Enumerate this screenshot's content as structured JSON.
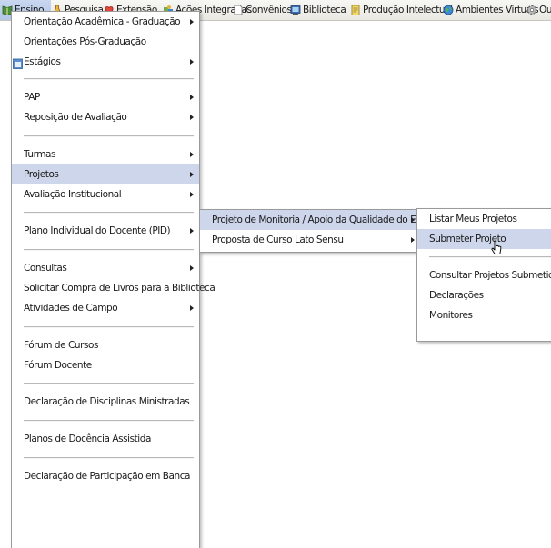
{
  "menubar": {
    "items": [
      {
        "label": "Ensino",
        "icon": "book-icon"
      },
      {
        "label": "Pesquisa",
        "icon": "flask-icon"
      },
      {
        "label": "Extensão",
        "icon": "heart-icon"
      },
      {
        "label": "Ações Integradas",
        "icon": "puzzle-icon"
      },
      {
        "label": "Convênios",
        "icon": "document-icon"
      },
      {
        "label": "Biblioteca",
        "icon": "monitor-icon"
      },
      {
        "label": "Produção Intelectual",
        "icon": "notepad-icon"
      },
      {
        "label": "Ambientes Virtuais",
        "icon": "globe-icon"
      },
      {
        "label": "Outros",
        "icon": "gear-icon"
      }
    ]
  },
  "ensino_menu": {
    "items": [
      {
        "label": "Orientação Acadêmica - Graduação",
        "submenu": true
      },
      {
        "label": "Orientações Pós-Graduação",
        "submenu": false
      },
      {
        "label": "Estágios",
        "submenu": true
      },
      {
        "label": "PAP",
        "submenu": true
      },
      {
        "label": "Reposição de Avaliação",
        "submenu": true
      },
      {
        "label": "Turmas",
        "submenu": true
      },
      {
        "label": "Projetos",
        "submenu": true
      },
      {
        "label": "Avaliação Institucional",
        "submenu": true
      },
      {
        "label": "Plano Individual do Docente (PID)",
        "submenu": true
      },
      {
        "label": "Consultas",
        "submenu": true
      },
      {
        "label": "Solicitar Compra de Livros para a Biblioteca",
        "submenu": false
      },
      {
        "label": "Atividades de Campo",
        "submenu": true
      },
      {
        "label": "Fórum de Cursos",
        "submenu": false
      },
      {
        "label": "Fórum Docente",
        "submenu": false
      },
      {
        "label": "Declaração de Disciplinas Ministradas",
        "submenu": false
      },
      {
        "label": "Planos de Docência Assistida",
        "submenu": false
      },
      {
        "label": "Declaração de Participação em Banca",
        "submenu": false
      }
    ]
  },
  "projetos_menu": {
    "items": [
      {
        "label": "Projeto de Monitoria / Apoio da Qualidade do Ensino",
        "submenu": true
      },
      {
        "label": "Proposta de Curso Lato Sensu",
        "submenu": true
      }
    ]
  },
  "monitoria_menu": {
    "items": [
      {
        "label": "Listar Meus Projetos"
      },
      {
        "label": "Submeter Projeto"
      },
      {
        "label": "Consultar Projetos Submetidos"
      },
      {
        "label": "Declarações"
      },
      {
        "label": "Monitores"
      }
    ]
  },
  "colors": {
    "highlight": "#cdd6ea",
    "menubar_active": "#b9cbe8"
  }
}
